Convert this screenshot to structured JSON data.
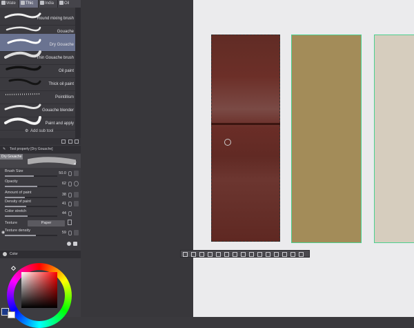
{
  "tabs": [
    "Wate",
    "Thic",
    "India",
    "Oil"
  ],
  "active_tab": 1,
  "brushes": [
    {
      "label": "Round mixing brush"
    },
    {
      "label": "Gouache"
    },
    {
      "label": "Dry Gouache"
    },
    {
      "label": "Thin Gouache brush"
    },
    {
      "label": "Oil paint"
    },
    {
      "label": "Thick oil paint"
    },
    {
      "label": "Pointillism"
    },
    {
      "label": "Gouache blender"
    },
    {
      "label": "Paint and apply"
    }
  ],
  "selected_brush": 2,
  "add_sub_tool": "Add sub tool",
  "tool_property_title": "Tool property [Dry Gouache]",
  "preview_label": "Dry Gouache",
  "properties": [
    {
      "label": "Brush Size",
      "value": "50.0",
      "fill": 0.55
    },
    {
      "label": "Opacity",
      "value": "62",
      "fill": 0.62
    },
    {
      "label": "Amount of paint",
      "value": "38",
      "fill": 0.38
    },
    {
      "label": "Density of paint",
      "value": "41",
      "fill": 0.41
    },
    {
      "label": "Color stretch",
      "value": "44",
      "fill": 0.44
    }
  ],
  "texture": {
    "label": "Texture",
    "value": "Paper"
  },
  "texture_density": {
    "label": "Texture density",
    "value": "59",
    "fill": 0.59
  },
  "color_header": "Color",
  "colors": {
    "main": "#1c3a8a",
    "sub": "#ffffff",
    "swatch_red": "#6a2d27",
    "swatch_tan": "#a38c59",
    "swatch_beige": "#d6cdbe",
    "selection_green": "#4bd08e"
  }
}
